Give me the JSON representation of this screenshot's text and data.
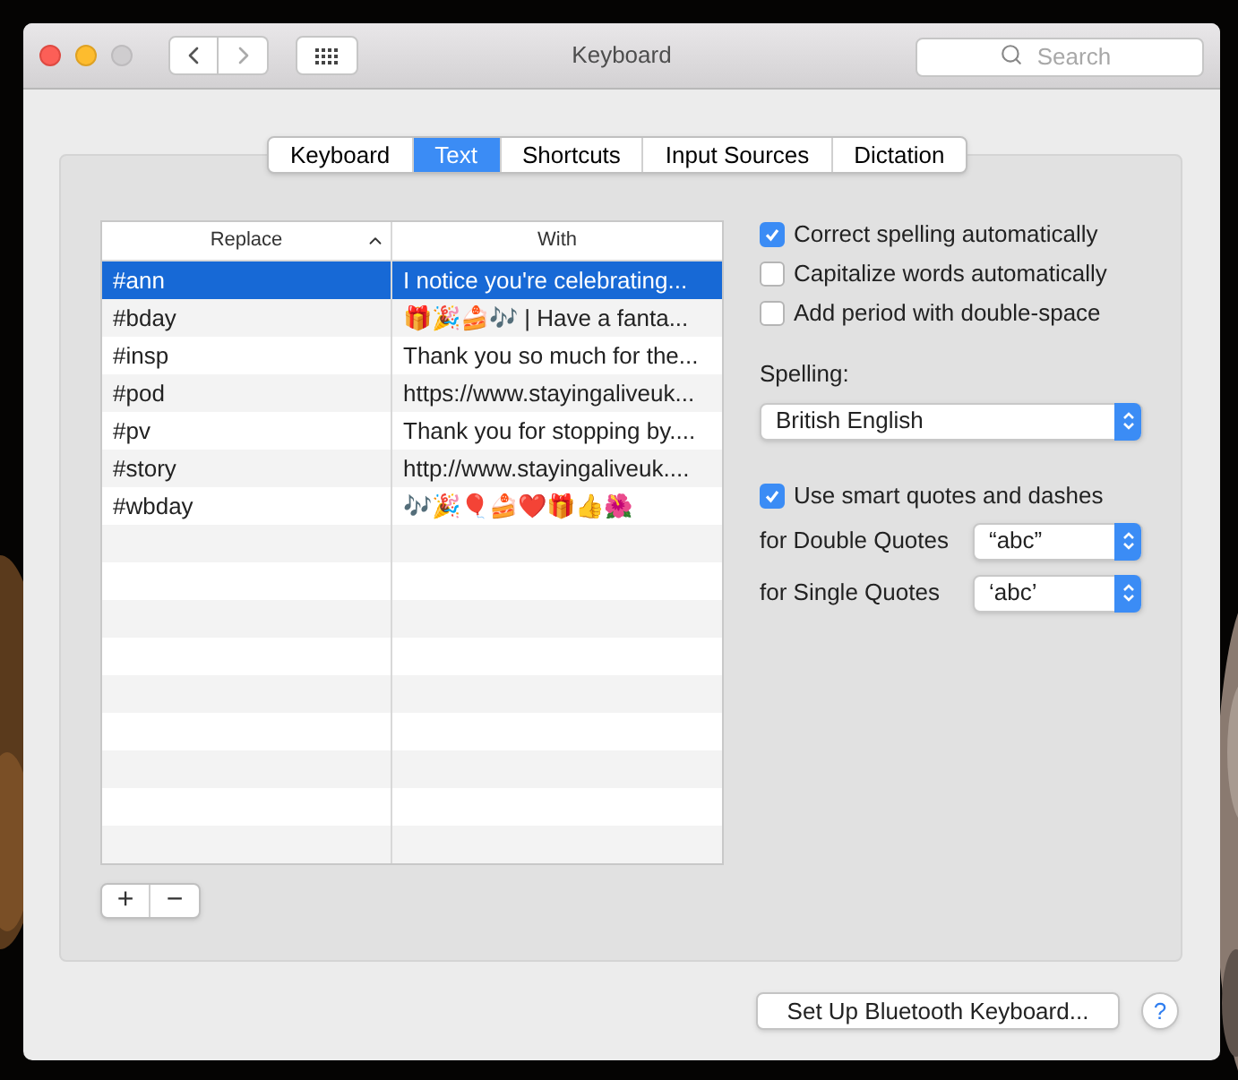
{
  "window": {
    "title": "Keyboard",
    "search": {
      "placeholder": "Search"
    }
  },
  "tabs": [
    {
      "label": "Keyboard",
      "selected": false
    },
    {
      "label": "Text",
      "selected": true
    },
    {
      "label": "Shortcuts",
      "selected": false
    },
    {
      "label": "Input Sources",
      "selected": false
    },
    {
      "label": "Dictation",
      "selected": false
    }
  ],
  "table": {
    "columns": [
      {
        "label": "Replace",
        "sorted": true
      },
      {
        "label": "With",
        "sorted": false
      }
    ],
    "rows": [
      {
        "replace": "#ann",
        "with": "I notice you're celebrating...",
        "selected": true
      },
      {
        "replace": "#bday",
        "with": "🎁🎉🍰🎶 | Have a fanta...",
        "selected": false
      },
      {
        "replace": "#insp",
        "with": "Thank you so much for the...",
        "selected": false
      },
      {
        "replace": "#pod",
        "with": "https://www.stayingaliveuk...",
        "selected": false
      },
      {
        "replace": "#pv",
        "with": "Thank you for stopping by....",
        "selected": false
      },
      {
        "replace": "#story",
        "with": "http://www.stayingaliveuk....",
        "selected": false
      },
      {
        "replace": "#wbday",
        "with": "🎶🎉🎈🍰❤️🎁👍🌺",
        "selected": false
      }
    ],
    "add_button": "+",
    "remove_button": "−"
  },
  "options": [
    {
      "label": "Correct spelling automatically",
      "checked": true
    },
    {
      "label": "Capitalize words automatically",
      "checked": false
    },
    {
      "label": "Add period with double-space",
      "checked": false
    }
  ],
  "spelling": {
    "label": "Spelling:",
    "value": "British English"
  },
  "smart_quotes": {
    "label": "Use smart quotes and dashes",
    "checked": true,
    "double": {
      "label": "for Double Quotes",
      "value": "“abc”"
    },
    "single": {
      "label": "for Single Quotes",
      "value": "‘abc’"
    }
  },
  "bluetooth_button": "Set Up Bluetooth Keyboard...",
  "help_button": "?"
}
